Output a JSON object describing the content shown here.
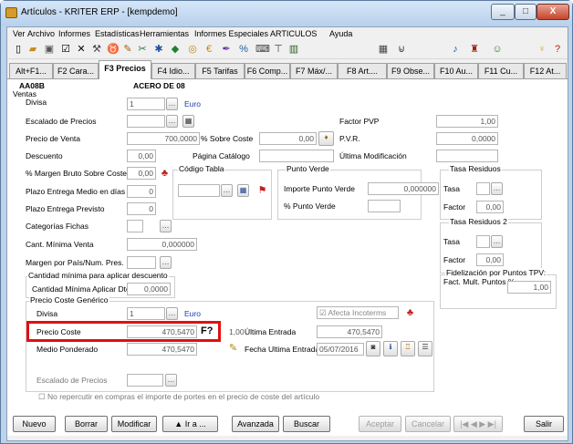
{
  "window": {
    "title": "Artículos - KRITER ERP - [kempdemo]",
    "min": "_",
    "max": "□",
    "close": "X"
  },
  "menu": [
    "Ver",
    "Archivo",
    "Informes",
    "Estadísticas",
    "Herramientas",
    "Informes Especiales ARTICULOS",
    "Ayuda"
  ],
  "toolbar_icons": [
    "new-doc-icon",
    "open-folder-icon",
    "save-icon",
    "edit-icon",
    "delete-icon",
    "tools-icon",
    "trophy-icon",
    "pencil-icon",
    "scissors-icon",
    "snowflake-icon",
    "bottle-icon",
    "coins-icon",
    "euro-icon",
    "pen-icon",
    "percent-icon",
    "keyboard-icon",
    "filter-icon",
    "bar-chart-icon",
    "calculator-icon",
    "cart-icon",
    "cream-icon",
    "wallet-icon",
    "money-icon",
    "lightbulb-icon",
    "help-icon"
  ],
  "tabs": [
    "Alt+F1...",
    "F2 Cara...",
    "F3 Precios",
    "F4 Idio...",
    "F5 Tarifas",
    "F6 Comp...",
    "F7 Máx/...",
    "F8 Art....",
    "F9 Obse...",
    "F10 Au...",
    "F11 Cu...",
    "F12 At..."
  ],
  "header": {
    "code": "AA08B",
    "name": "ACERO DE 08"
  },
  "ventas": {
    "section": "Ventas",
    "divisa_label": "Divisa",
    "divisa_value": "1",
    "divisa_name": "Euro",
    "escalado_label": "Escalado de Precios",
    "factor_pvp_label": "Factor PVP",
    "factor_pvp_value": "1,00",
    "precio_venta_label": "Precio de Venta",
    "precio_venta_value": "700,0000",
    "sobre_coste_label": "% Sobre Coste",
    "sobre_coste_value": "0,00",
    "pvr_label": "P.V.R.",
    "pvr_value": "0,0000",
    "descuento_label": "Descuento",
    "descuento_value": "0,00",
    "pagina_label": "Página Catálogo",
    "ultima_mod_label": "Última Modificación",
    "margen_label": "% Margen Bruto Sobre Coste",
    "margen_value": "0,00",
    "plazo_medio_label": "Plazo Entrega Medio en días",
    "plazo_medio_value": "0",
    "plazo_prev_label": "Plazo Entrega Previsto",
    "plazo_prev_value": "0",
    "categorias_label": "Categorías Fichas",
    "cant_min_label": "Cant. Mínima Venta",
    "cant_min_value": "0,000000",
    "margen_pais_label": "Margen por País/Num. Pres."
  },
  "codigo_tabla": {
    "label": "Código Tabla"
  },
  "punto_verde": {
    "title": "Punto Verde",
    "importe_label": "Importe Punto Verde",
    "importe_value": "0,000000",
    "pct_label": "% Punto Verde"
  },
  "tasa_residuos": {
    "title": "Tasa Residuos",
    "tasa_label": "Tasa",
    "factor_label": "Factor",
    "factor_value": "0,00"
  },
  "tasa_residuos2": {
    "title": "Tasa Residuos 2",
    "tasa_label": "Tasa",
    "factor_label": "Factor",
    "factor_value": "0,00"
  },
  "fidelizacion": {
    "title": "Fidelización por Puntos TPV:",
    "label": "Fact. Mult. Puntos %",
    "value": "1,00"
  },
  "cant_desc": {
    "title": "Cantidad mínima para aplicar descuento",
    "label": "Cantidad Mínima Aplicar Dto",
    "value": "0,0000"
  },
  "coste": {
    "title": "Precio Coste Genérico",
    "divisa_label": "Divisa",
    "divisa_value": "1",
    "divisa_name": "Euro",
    "afecta_label": "Afecta Incoterms",
    "precio_coste_label": "Precio Coste",
    "precio_coste_value": "470,5470",
    "f_label": "F?",
    "factor_value": "1,00",
    "ultima_entrada_label": "Última Entrada",
    "ultima_entrada_value": "470,5470",
    "medio_label": "Medio Ponderado",
    "medio_value": "470,5470",
    "fecha_label": "Fecha Ultima Entrada",
    "fecha_value": "05/07/2016",
    "escalado_label": "Escalado de Precios",
    "no_repercutir_label": "No repercutir en compras el importe de portes en el precio de coste del artículo"
  },
  "footer": {
    "nuevo": "Nuevo",
    "borrar": "Borrar",
    "modificar": "Modificar",
    "ira": "▲ Ir a ...",
    "avanzada": "Avanzada",
    "buscar": "Buscar",
    "aceptar": "Aceptar",
    "cancelar": "Cancelar",
    "nav": "|◀ ◀ ▶ ▶|",
    "salir": "Salir"
  },
  "colors": {
    "highlight": "#e01010",
    "link": "#1a3fb0"
  }
}
